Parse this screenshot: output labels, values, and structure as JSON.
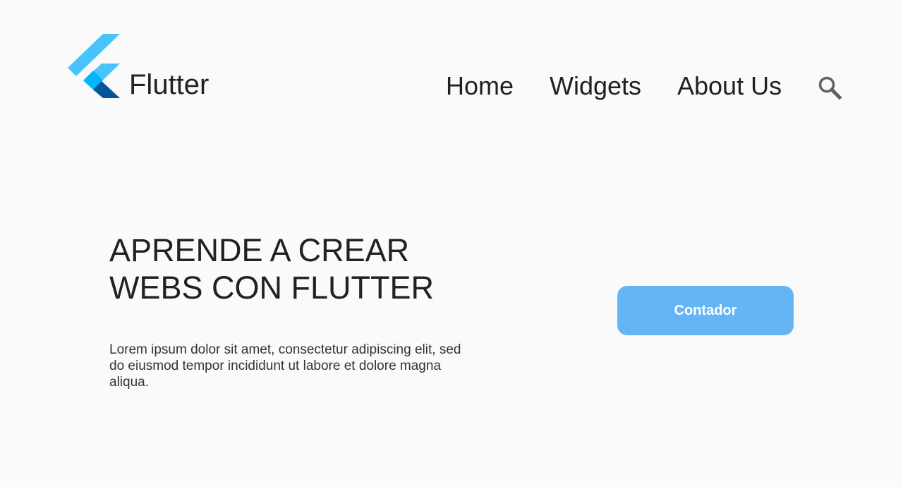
{
  "navbar": {
    "brand": "Flutter",
    "items": [
      {
        "label": "Home"
      },
      {
        "label": "Widgets"
      },
      {
        "label": "About Us"
      }
    ],
    "search_icon": "search-icon",
    "logo_icon": "flutter-logo-icon"
  },
  "hero": {
    "title_lines": [
      "APRENDE A CREAR",
      "WEBS CON FLUTTER"
    ],
    "description": "Lorem ipsum dolor sit amet, consectetur adipiscing elit, sed do eiusmod tempor incididunt ut labore et dolore magna aliqua."
  },
  "counter": {
    "button_label": "Contador"
  },
  "colors": {
    "background": "#fafafa",
    "text": "#212121",
    "button": "#64b5f6",
    "button_text": "#ffffff",
    "logo_light": "#47c5fb",
    "logo_mid": "#00b5f8",
    "logo_dark": "#02569b",
    "search_icon": "#616161"
  }
}
